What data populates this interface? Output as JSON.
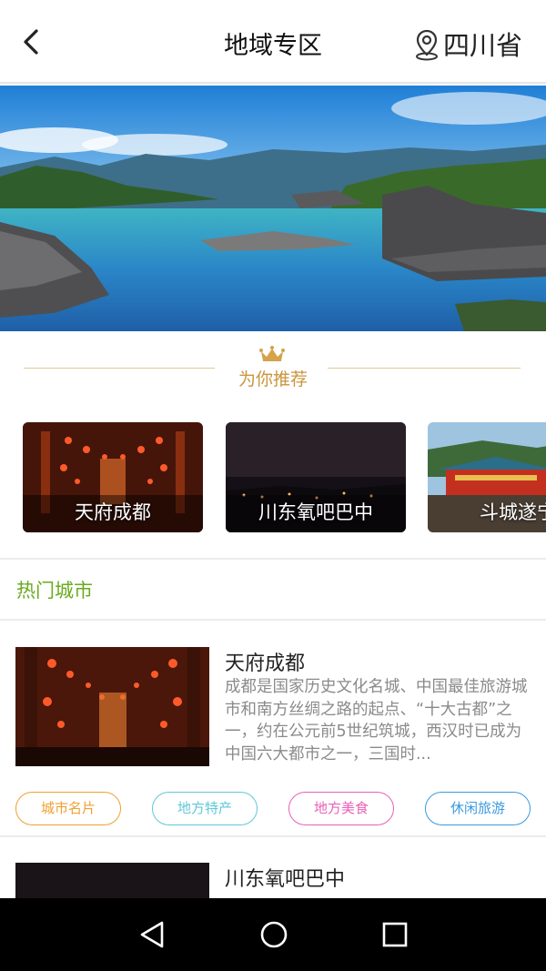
{
  "header": {
    "title": "地域专区",
    "location": "四川省"
  },
  "recommend": {
    "title": "为你推荐",
    "cards": [
      {
        "label": "天府成都"
      },
      {
        "label": "川东氧吧巴中"
      },
      {
        "label": "斗城遂宁"
      }
    ]
  },
  "hot": {
    "title": "热门城市",
    "cities": [
      {
        "name": "天府成都",
        "desc": "成都是国家历史文化名城、中国最佳旅游城市和南方丝绸之路的起点、“十大古都”之一，约在公元前5世纪筑城，西汉时已成为中国六大都市之一，三国时..."
      },
      {
        "name": "川东氧吧巴中",
        "desc": ""
      }
    ],
    "tags": [
      {
        "label": "城市名片",
        "color": "#f0a030"
      },
      {
        "label": "地方特产",
        "color": "#5fc8d8"
      },
      {
        "label": "地方美食",
        "color": "#e860b8"
      },
      {
        "label": "休闲旅游",
        "color": "#3a9ae0"
      }
    ]
  },
  "colors": {
    "accent_gold": "#c8963c",
    "hot_green": "#6aab1e",
    "desc_gray": "#8a8a8a"
  }
}
